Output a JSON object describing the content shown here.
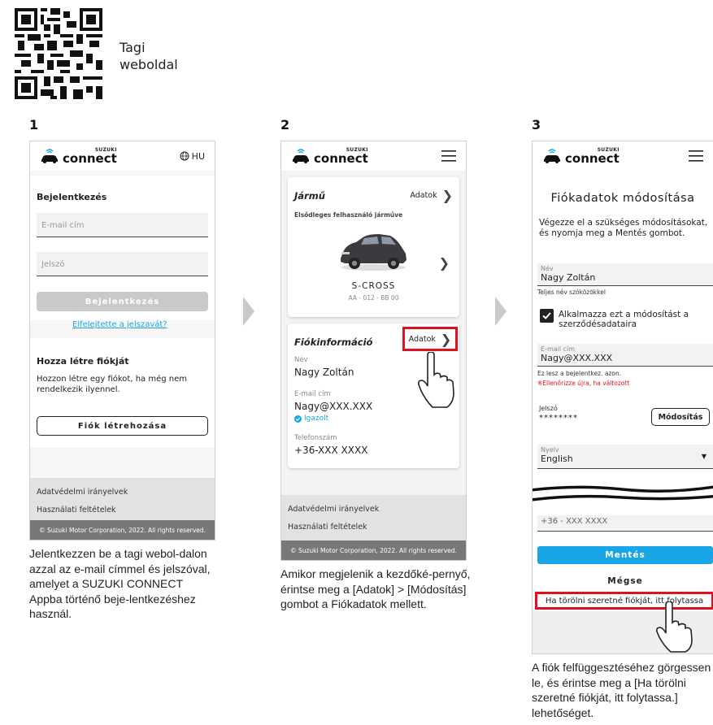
{
  "qr": {
    "label": "Tagi weboldal"
  },
  "steps": [
    {
      "num": "1",
      "caption": "Jelentkezzen be a tagi webol-dalon azzal az e-mail címmel és jelszóval, amelyet a SUZUKI CONNECT Appba történő beje-lentkezéshez használ."
    },
    {
      "num": "2",
      "caption": "Amikor megjelenik a kezdőké-pernyő, érintse meg a [Adatok] > [Módosítás] gombot a Fiókadatok mellett."
    },
    {
      "num": "3",
      "caption": "A fiók felfüggesztéséhez görgessen le, és érintse meg a [Ha törölni szeretné fiókját, itt folytassa.] lehetőséget."
    }
  ],
  "app": {
    "brand_small": "SUZUKI",
    "brand_large": "connect"
  },
  "phone1": {
    "lang": "HU",
    "login_title": "Bejelentkezés",
    "email_placeholder": "E-mail cím",
    "password_placeholder": "Jelszó",
    "login_button": "Bejelentkezés",
    "forgot_link": "Elfelejtette a jelszavát?",
    "create_title": "Hozza létre fiókját",
    "create_text": "Hozzon létre egy fiókot, ha még nem rendelkezik ilyennel.",
    "create_button": "Fiók létrehozása",
    "footer_privacy": "Adatvédelmi irányelvek",
    "footer_terms": "Használati feltételek",
    "copyright": "© Suzuki Motor Corporation, 2022. All rights reserved."
  },
  "phone2": {
    "vehicle_title": "Jármű",
    "vehicle_details": "Adatok",
    "primary_vehicle": "Elsődleges felhasználó járműve",
    "car_model": "S-CROSS",
    "plate": "AA - 012 - BB 00",
    "account_title": "Fiókinformáció",
    "account_details": "Adatok",
    "name_label": "Név",
    "name_value": "Nagy Zoltán",
    "email_label": "E-mail cím",
    "email_value": "Nagy@XXX.XXX",
    "verified": "Igazolt",
    "phone_label": "Telefonszám",
    "phone_value": "+36-XXX XXXX",
    "footer_privacy": "Adatvédelmi irányelvek",
    "footer_terms": "Használati feltételek",
    "copyright": "© Suzuki Motor Corporation, 2022. All rights reserved."
  },
  "phone3": {
    "title": "Fiókadatok módosítása",
    "instruction": "Végezze el a szükséges módosításokat, és nyomja meg a Mentés gombot.",
    "name_label": "Név",
    "name_value": "Nagy Zoltán",
    "name_hint": "Teljes név szóközökkel",
    "apply_checkbox": "Alkalmazza ezt a módosítást a szerződésadataira",
    "email_label": "E-mail cím",
    "email_value": "Nagy@XXX.XXX",
    "email_hint": "Ez lesz a bejelentkez. azon.",
    "email_warning": "※Ellenőrizze újra, ha változott",
    "password_label": "Jelszó",
    "password_value": "********",
    "modify_button": "Módosítás",
    "language_label": "Nyelv",
    "language_value": "English",
    "phone_value": "+36 - XXX XXXX",
    "save_button": "Mentés",
    "cancel_button": "Mégse",
    "delete_link": "Ha törölni szeretné fiókját, itt folytassa"
  },
  "colors": {
    "accent_blue": "#1aa6e6",
    "highlight_red": "#e2101e"
  }
}
